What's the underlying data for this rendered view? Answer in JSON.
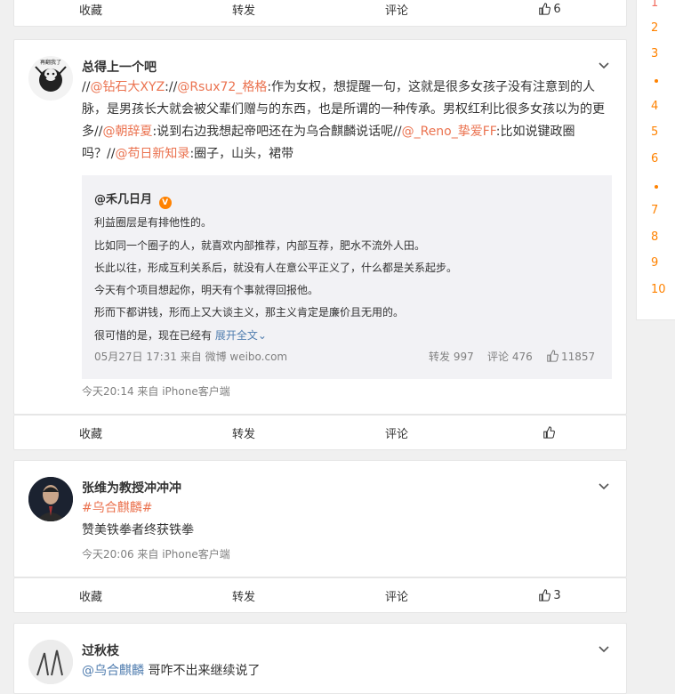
{
  "actions_top": {
    "collect": "收藏",
    "forward": "转发",
    "comment": "评论",
    "like": "6"
  },
  "post1": {
    "user": "总得上一个吧",
    "seg1": "//",
    "m1": "@钻石大XYZ",
    "seg2": "://",
    "m2": "@Rsux72_格格",
    "seg3": ":作为女权，想提醒一句，这就是很多女孩子没有注意到的人脉，是男孩长大就会被父辈们赠与的东西，也是所谓的一种传承。男权红利比很多女孩以为的更多//",
    "m3": "@朝辞夏",
    "seg4": ":说到右边我想起帝吧还在为乌合麒麟说话呢//",
    "m4": "@_Reno_挚爱FF",
    "seg5": ":比如说键政圈吗？//",
    "m5": "@苟日新知录",
    "seg6": ":圈子，山头，裙带",
    "quote": {
      "author": "@禾几日月",
      "lines": [
        "利益圈层是有排他性的。",
        "比如同一个圈子的人，就喜欢内部推荐，内部互荐，肥水不流外人田。",
        "长此以往，形成互利关系后，就没有人在意公平正义了，什么都是关系起步。",
        "今天有个项目想起你，明天有个事就得回报他。",
        "形而下都讲钱，形而上又大谈主义，那主义肯定是廉价且无用的。"
      ],
      "last_line": "很可惜的是，现在已经有",
      "expand": "展开全文",
      "time": "05月27日 17:31 来自 微博 weibo.com",
      "forward": "转发 997",
      "comment": "评论 476",
      "like": "11857"
    },
    "time": "今天20:14  来自 iPhone客户端",
    "avatar_text": "再翻我了"
  },
  "actions_p1": {
    "collect": "收藏",
    "forward": "转发",
    "comment": "评论",
    "like": ""
  },
  "post2": {
    "user": "张维为教授冲冲冲",
    "tag": "#乌合麒麟#",
    "text": "赞美铁拳者终获铁拳",
    "time": "今天20:06  来自 iPhone客户端"
  },
  "actions_p2": {
    "collect": "收藏",
    "forward": "转发",
    "comment": "评论",
    "like": "3"
  },
  "post3": {
    "user": "过秋枝",
    "mention": "@乌合麒麟",
    "text": " 哥咋不出来继续说了"
  },
  "sidebar": {
    "ranks": [
      "1",
      "2",
      "3",
      "4",
      "5",
      "6",
      "7",
      "8",
      "9",
      "10"
    ]
  },
  "colors": {
    "accent": "#eb7350",
    "link": "#507daf",
    "meta": "#808080"
  }
}
